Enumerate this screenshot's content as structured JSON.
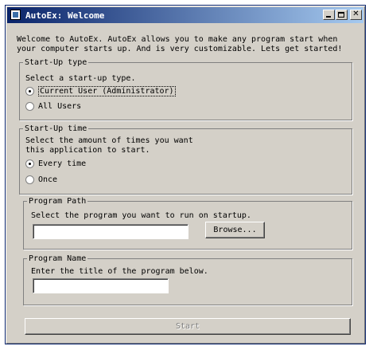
{
  "window": {
    "title": "AutoEx: Welcome"
  },
  "intro": {
    "line1": "Welcome to AutoEx. AutoEx allows you to make any program start when",
    "line2": "your computer starts up. And is very customizable. Lets get started!"
  },
  "startup_type": {
    "legend": "Start-Up type",
    "prompt": "Select a start-up type.",
    "options": [
      {
        "label": "Current User (Administrator)",
        "checked": true
      },
      {
        "label": "All Users",
        "checked": false
      }
    ]
  },
  "startup_time": {
    "legend": "Start-Up time",
    "prompt_line1": "Select the amount of times you want",
    "prompt_line2": "this application to start.",
    "options": [
      {
        "label": "Every time",
        "checked": true
      },
      {
        "label": "Once",
        "checked": false
      }
    ]
  },
  "program_path": {
    "legend": "Program Path",
    "prompt": "Select the program you want to run on startup.",
    "value": "",
    "browse_label": "Browse..."
  },
  "program_name": {
    "legend": "Program Name",
    "prompt": "Enter the title of the program below.",
    "value": ""
  },
  "start_button": {
    "label": "Start",
    "enabled": false
  }
}
